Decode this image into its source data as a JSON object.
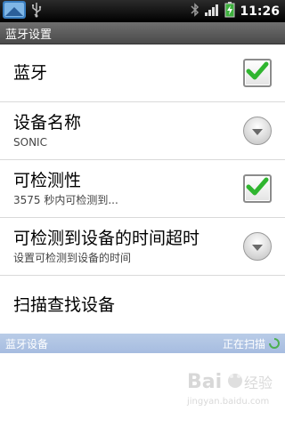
{
  "status_bar": {
    "time": "11:26"
  },
  "title_bar": {
    "title": "蓝牙设置"
  },
  "preferences": [
    {
      "title": "蓝牙",
      "summary": "",
      "control": "checkbox",
      "checked": true
    },
    {
      "title": "设备名称",
      "summary": "SONIC",
      "control": "dropdown"
    },
    {
      "title": "可检测性",
      "summary": "3575 秒内可检测到...",
      "control": "checkbox",
      "checked": true
    },
    {
      "title": "可检测到设备的时间超时",
      "summary": "设置可检测到设备的时间",
      "control": "dropdown"
    },
    {
      "title": "扫描查找设备",
      "summary": "",
      "control": "none"
    }
  ],
  "section": {
    "label": "蓝牙设备",
    "status": "正在扫描"
  },
  "watermark": {
    "brand": "Bai",
    "brand2": "经验",
    "url": "jingyan.baidu.com"
  },
  "colors": {
    "checkmark": "#2fb52f",
    "section_bg": "#a9bfe2",
    "status_bar_bg": "#000000"
  },
  "icons": [
    "app-notification-icon",
    "usb-icon",
    "bluetooth-icon",
    "signal-icon",
    "battery-icon",
    "check-icon",
    "chevron-down-icon",
    "spinner-icon"
  ]
}
